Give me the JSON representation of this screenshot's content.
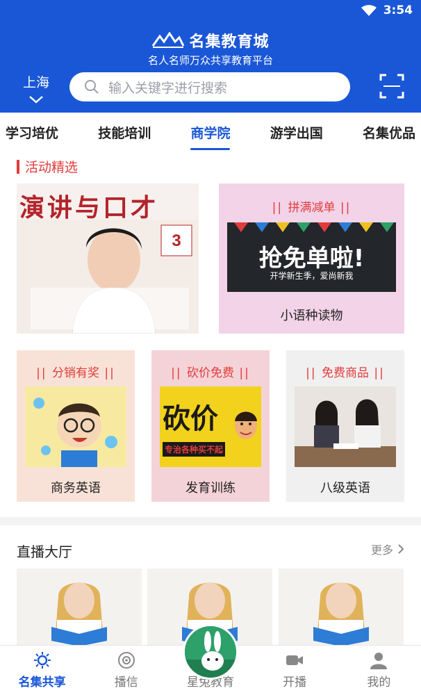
{
  "status": {
    "time": "3:54"
  },
  "header": {
    "brand_title": "名集教育城",
    "brand_subtitle": "名人名师万众共享教育平台",
    "city": "上海",
    "search_placeholder": "输入关键字进行搜索"
  },
  "tabs": [
    "学习培优",
    "技能培训",
    "商学院",
    "游学出国",
    "名集优品"
  ],
  "active_tab": "商学院",
  "activities": {
    "title": "活动精选",
    "magazine_cover_title": "演讲与口才",
    "promo_big": {
      "label": "拼满减单",
      "image_text": "抢免单啦!",
      "image_sub": "开学新生季，爱尚新我",
      "caption": "小语种读物"
    },
    "promo_small": [
      {
        "label": "分销有奖",
        "caption": "商务英语"
      },
      {
        "label": "砍价免费",
        "image_text": "砍价",
        "image_sub": "专治各种买不起",
        "caption": "发育训练"
      },
      {
        "label": "免费商品",
        "caption": "八级英语"
      }
    ]
  },
  "live": {
    "title": "直播大厅",
    "more": "更多"
  },
  "bottom_nav": [
    {
      "label": "名集共享",
      "icon": "sun-icon",
      "active": true
    },
    {
      "label": "播信",
      "icon": "broadcast-icon",
      "active": false
    },
    {
      "label": "星兔教育",
      "icon": "rabbit-badge-icon",
      "active": false
    },
    {
      "label": "开播",
      "icon": "video-camera-icon",
      "active": false
    },
    {
      "label": "我的",
      "icon": "user-icon",
      "active": false
    }
  ],
  "colors": {
    "primary": "#1a57d6",
    "accent_red": "#e23c3c"
  }
}
